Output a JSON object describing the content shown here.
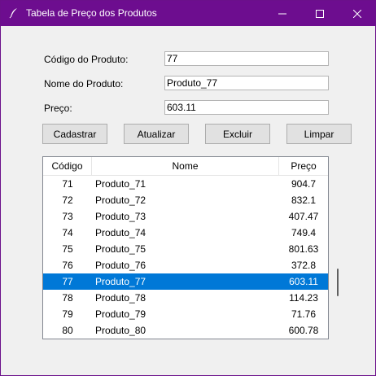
{
  "window": {
    "title": "Tabela de Preço dos Produtos",
    "icon": "feather-icon"
  },
  "form": {
    "code_label": "Código do Produto:",
    "code_value": "77",
    "name_label": "Nome do Produto:",
    "name_value": "Produto_77",
    "price_label": "Preço:",
    "price_value": "603.11"
  },
  "buttons": {
    "cadastrar": "Cadastrar",
    "atualizar": "Atualizar",
    "excluir": "Excluir",
    "limpar": "Limpar"
  },
  "table": {
    "columns": [
      "Código",
      "Nome",
      "Preço"
    ],
    "rows": [
      {
        "code": "71",
        "name": "Produto_71",
        "price": "904.7"
      },
      {
        "code": "72",
        "name": "Produto_72",
        "price": "832.1"
      },
      {
        "code": "73",
        "name": "Produto_73",
        "price": "407.47"
      },
      {
        "code": "74",
        "name": "Produto_74",
        "price": "749.4"
      },
      {
        "code": "75",
        "name": "Produto_75",
        "price": "801.63"
      },
      {
        "code": "76",
        "name": "Produto_76",
        "price": "372.8"
      },
      {
        "code": "77",
        "name": "Produto_77",
        "price": "603.11"
      },
      {
        "code": "78",
        "name": "Produto_78",
        "price": "114.23"
      },
      {
        "code": "79",
        "name": "Produto_79",
        "price": "71.76"
      },
      {
        "code": "80",
        "name": "Produto_80",
        "price": "600.78"
      }
    ],
    "selected_code": "77"
  },
  "colors": {
    "titlebar": "#6d0d8f",
    "selection": "#0078d7"
  }
}
